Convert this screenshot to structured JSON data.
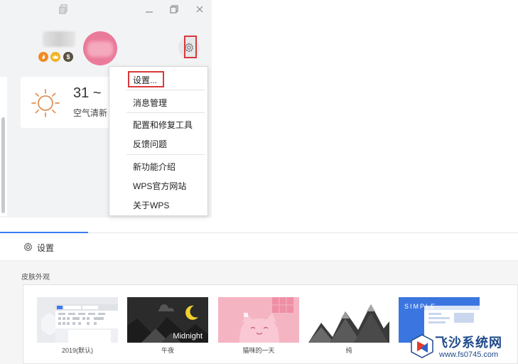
{
  "window": {
    "controls": [
      "restore-icon",
      "minimize-icon",
      "maximize-icon",
      "close-icon"
    ]
  },
  "profile": {
    "badges": [
      {
        "icon": "flame-icon",
        "color": "#f08a24"
      },
      {
        "icon": "crown-icon",
        "color": "#f0b428"
      },
      {
        "icon": "dollar-icon",
        "color": "#5a5040",
        "glyph": "$"
      }
    ],
    "avatar_color": "#ea7a9a"
  },
  "weather": {
    "temperature": "31 ~",
    "description": "空气清新",
    "icon": "sun-icon",
    "icon_color": "#e0915a"
  },
  "menu": {
    "items": [
      {
        "label": "设置..."
      },
      {
        "label": "消息管理"
      },
      {
        "label": "配置和修复工具"
      },
      {
        "label": "反馈问题"
      },
      {
        "label": "新功能介绍"
      },
      {
        "label": "WPS官方网站"
      },
      {
        "label": "关于WPS"
      }
    ],
    "highlight_color": "#d9383a"
  },
  "settings": {
    "title": "设置",
    "icon": "gear-icon",
    "accent": "#3b7cf5",
    "section_label": "皮肤外观",
    "skins": [
      {
        "caption": "2019(默认)"
      },
      {
        "caption": "午夜",
        "overlay_text": "Midnight"
      },
      {
        "caption": "猫咪的一天"
      },
      {
        "caption": "纯"
      },
      {
        "caption": "",
        "overlay_text": "SIMPLE"
      }
    ]
  },
  "watermark": {
    "title": "飞沙系统网",
    "url": "www.fs0745.com"
  }
}
